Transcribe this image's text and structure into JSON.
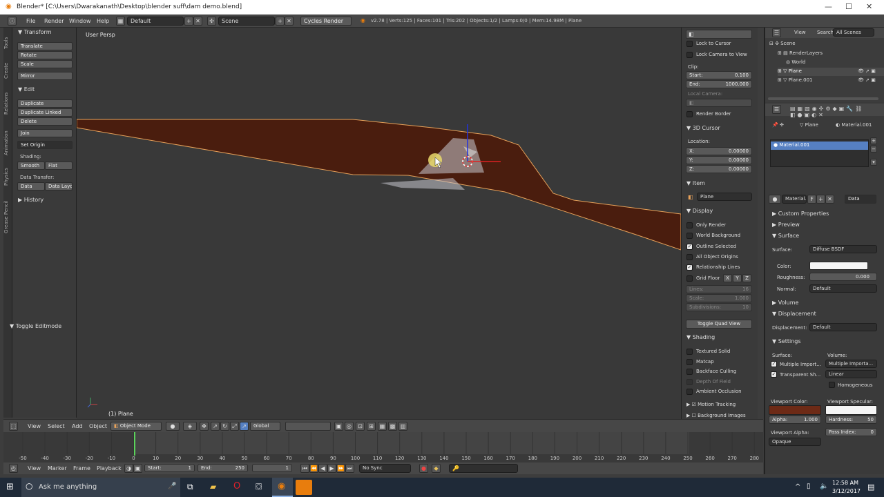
{
  "window": {
    "title": "Blender* [C:\\Users\\Dwarakanath\\Desktop\\blender suff\\dam demo.blend]",
    "minimize": "—",
    "maximize": "☐",
    "close": "✕"
  },
  "menu": {
    "file": "File",
    "render": "Render",
    "window": "Window",
    "help": "Help",
    "layout": "Default",
    "scene": "Scene",
    "engine": "Cycles Render",
    "stats": "v2.78 | Verts:125 | Faces:101 | Tris:202 | Objects:1/2 | Lamps:0/0 | Mem:14.98M | Plane"
  },
  "tabs": [
    "Tools",
    "Create",
    "Relations",
    "Animation",
    "Physics",
    "Grease Pencil"
  ],
  "toolshelf": {
    "transform_header": "Transform",
    "translate": "Translate",
    "rotate": "Rotate",
    "scale": "Scale",
    "mirror": "Mirror",
    "edit_header": "Edit",
    "duplicate": "Duplicate",
    "duplicate_linked": "Duplicate Linked",
    "delete": "Delete",
    "join": "Join",
    "set_origin": "Set Origin",
    "shading_label": "Shading:",
    "smooth": "Smooth",
    "flat": "Flat",
    "data_transfer_label": "Data Transfer:",
    "data": "Data",
    "data_layo": "Data Layo",
    "history_header": "History",
    "toggle_editmode": "Toggle Editmode"
  },
  "viewport": {
    "label": "User Persp",
    "object_label": "(1) Plane"
  },
  "npanel": {
    "lock_to_cursor": "Lock to Cursor",
    "lock_camera": "Lock Camera to View",
    "clip_label": "Clip:",
    "clip_start": "Start:",
    "clip_start_val": "0.100",
    "clip_end": "End:",
    "clip_end_val": "1000.000",
    "local_camera": "Local Camera:",
    "render_border": "Render Border",
    "cursor_header": "3D Cursor",
    "location_label": "Location:",
    "x": "X:",
    "y": "Y:",
    "z": "Z:",
    "xv": "0.00000",
    "yv": "0.00000",
    "zv": "0.00000",
    "item_header": "Item",
    "item_name": "Plane",
    "display_header": "Display",
    "only_render": "Only Render",
    "world_bg": "World Background",
    "outline_selected": "Outline Selected",
    "all_origins": "All Object Origins",
    "relationship_lines": "Relationship Lines",
    "grid_floor": "Grid Floor",
    "gx": "X",
    "gy": "Y",
    "gz": "Z",
    "lines": "Lines:",
    "lines_v": "16",
    "scale": "Scale:",
    "scale_v": "1.000",
    "subdiv": "Subdivisions:",
    "subdiv_v": "10",
    "toggle_quad": "Toggle Quad View",
    "shading_header": "Shading",
    "textured_solid": "Textured Solid",
    "matcap": "Matcap",
    "backface": "Backface Culling",
    "dof": "Depth Of Field",
    "ao": "Ambient Occlusion",
    "motion_tracking": "Motion Tracking",
    "bg_images": "Background Images"
  },
  "outliner": {
    "view": "View",
    "search": "Search",
    "all_scenes": "All Scenes",
    "scene": "Scene",
    "renderlayers": "RenderLayers",
    "world": "World",
    "plane": "Plane",
    "plane001": "Plane.001"
  },
  "props": {
    "crumb_plane": "Plane",
    "crumb_mat": "Material.001",
    "slot": "Material.001",
    "mat_name": "Material.",
    "mat_f": "F",
    "data": "Data",
    "custom_props": "Custom Properties",
    "preview": "Preview",
    "surface_header": "Surface",
    "surface_label": "Surface:",
    "surface_val": "Diffuse BSDF",
    "color_label": "Color:",
    "rough_label": "Roughness:",
    "rough_val": "0.000",
    "normal_label": "Normal:",
    "normal_val": "Default",
    "volume": "Volume",
    "displacement_header": "Displacement",
    "disp_label": "Displacement:",
    "disp_val": "Default",
    "settings_header": "Settings",
    "surf2": "Surface:",
    "vol2": "Volume:",
    "mult_imp": "Multiple Import...",
    "mult_imp2": "Multiple Importa...",
    "trans_sh": "Transparent Sh...",
    "linear": "Linear",
    "homog": "Homogeneous",
    "vp_color": "Viewport Color:",
    "vp_spec": "Viewport Specular:",
    "alpha": "Alpha:",
    "alpha_v": "1.000",
    "hardness": "Hardness:",
    "hardness_v": "50",
    "vp_alpha": "Viewport Alpha:",
    "pass_index": "Pass Index:",
    "pass_v": "0",
    "opaque": "Opaque"
  },
  "vpheader": {
    "view": "View",
    "select": "Select",
    "add": "Add",
    "object": "Object",
    "mode": "Object Mode",
    "orient": "Global"
  },
  "timeline": {
    "ticks": [
      "-50",
      "-40",
      "-30",
      "-20",
      "-10",
      "0",
      "10",
      "20",
      "30",
      "40",
      "50",
      "60",
      "70",
      "80",
      "90",
      "100",
      "110",
      "120",
      "130",
      "140",
      "150",
      "160",
      "170",
      "180",
      "190",
      "200",
      "210",
      "220",
      "230",
      "240",
      "250",
      "260",
      "270",
      "280"
    ]
  },
  "tlheader": {
    "view": "View",
    "marker": "Marker",
    "frame": "Frame",
    "playback": "Playback",
    "start": "Start:",
    "start_v": "1",
    "end": "End:",
    "end_v": "250",
    "current": "1",
    "sync": "No Sync"
  },
  "taskbar": {
    "search": "Ask me anything",
    "time": "12:58 AM",
    "date": "3/12/2017"
  },
  "colors": {
    "mesh": "#4a1d0e",
    "edge": "#e8a25a",
    "material_vp": "#6d2a16",
    "selected_slot": "#5680c2"
  }
}
